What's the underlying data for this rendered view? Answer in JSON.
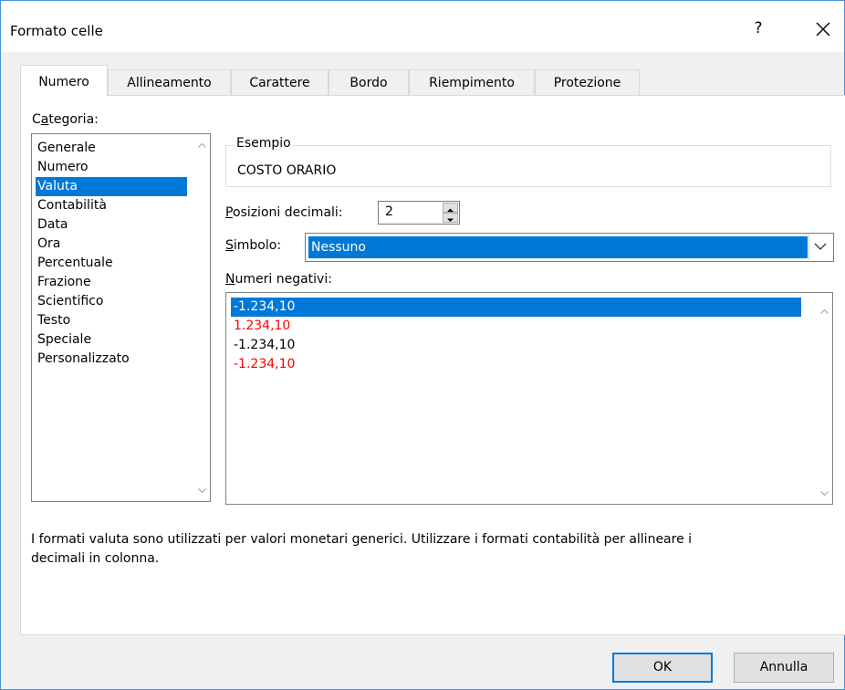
{
  "window": {
    "title": "Formato celle",
    "help_glyph": "?",
    "close_icon": "close-icon"
  },
  "tabs": [
    {
      "label": "Numero",
      "active": true
    },
    {
      "label": "Allineamento"
    },
    {
      "label": "Carattere"
    },
    {
      "label": "Bordo"
    },
    {
      "label": "Riempimento"
    },
    {
      "label": "Protezione"
    }
  ],
  "category": {
    "label_pre": "C",
    "label_accel": "a",
    "label_post": "tegoria:",
    "items": [
      "Generale",
      "Numero",
      "Valuta",
      "Contabilità",
      "Data",
      "Ora",
      "Percentuale",
      "Frazione",
      "Scientifico",
      "Testo",
      "Speciale",
      "Personalizzato"
    ],
    "selected": "Valuta"
  },
  "example": {
    "legend": "Esempio",
    "value": "COSTO ORARIO"
  },
  "decimals": {
    "label_accel": "P",
    "label_post": "osizioni decimali:",
    "value": "2"
  },
  "symbol": {
    "label_accel": "S",
    "label_post": "imbolo:",
    "value": "Nessuno"
  },
  "negatives": {
    "label_accel": "N",
    "label_post": "umeri negativi:",
    "items": [
      {
        "text": "-1.234,10",
        "color": "#000000",
        "selected": true
      },
      {
        "text": "1.234,10",
        "color": "#ff0000"
      },
      {
        "text": "-1.234,10",
        "color": "#000000"
      },
      {
        "text": "-1.234,10",
        "color": "#ff0000"
      }
    ]
  },
  "description_line1": "I formati valuta sono utilizzati per valori monetari generici. Utilizzare i formati contabilità per allineare i",
  "description_line2": "decimali in colonna.",
  "buttons": {
    "ok": "OK",
    "cancel": "Annulla"
  },
  "colors": {
    "accent": "#0078d7",
    "negative_red": "#ff0000"
  }
}
